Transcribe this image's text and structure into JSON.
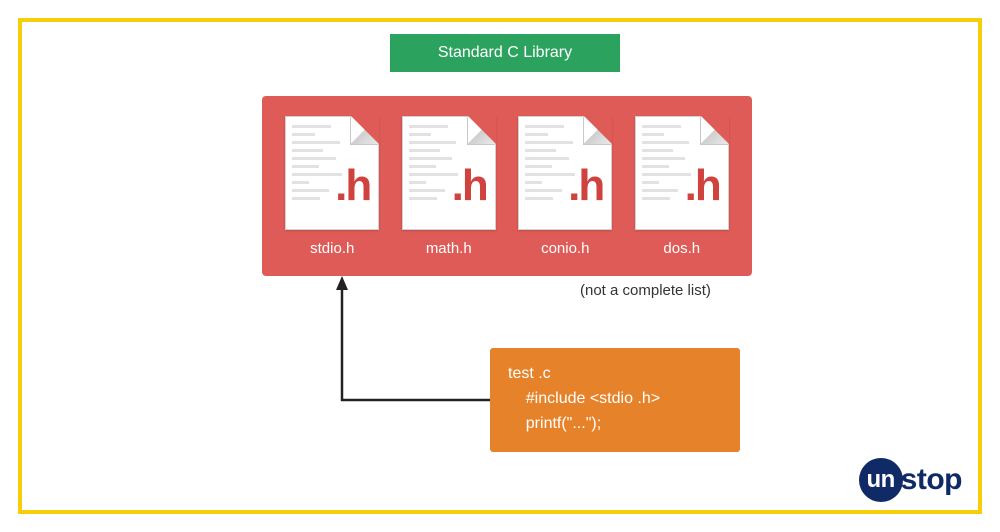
{
  "title": "Standard C Library",
  "file_ext_label": ".h",
  "files": [
    {
      "name": "stdio.h"
    },
    {
      "name": "math.h"
    },
    {
      "name": "conio.h"
    },
    {
      "name": "dos.h"
    }
  ],
  "note": "(not a complete list)",
  "code": "test .c\n    #include <stdio .h>\n    printf(\"...\");",
  "logo": {
    "circle": "un",
    "rest": "stop"
  }
}
